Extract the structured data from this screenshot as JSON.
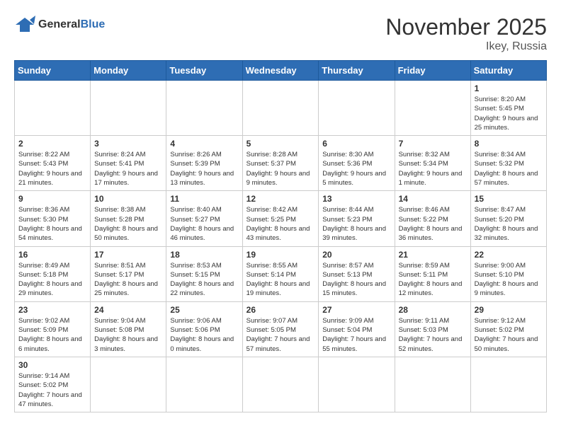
{
  "header": {
    "logo_general": "General",
    "logo_blue": "Blue",
    "month_title": "November 2025",
    "location": "Ikey, Russia"
  },
  "weekdays": [
    "Sunday",
    "Monday",
    "Tuesday",
    "Wednesday",
    "Thursday",
    "Friday",
    "Saturday"
  ],
  "weeks": [
    [
      {
        "day": "",
        "info": ""
      },
      {
        "day": "",
        "info": ""
      },
      {
        "day": "",
        "info": ""
      },
      {
        "day": "",
        "info": ""
      },
      {
        "day": "",
        "info": ""
      },
      {
        "day": "",
        "info": ""
      },
      {
        "day": "1",
        "info": "Sunrise: 8:20 AM\nSunset: 5:45 PM\nDaylight: 9 hours and 25 minutes."
      }
    ],
    [
      {
        "day": "2",
        "info": "Sunrise: 8:22 AM\nSunset: 5:43 PM\nDaylight: 9 hours and 21 minutes."
      },
      {
        "day": "3",
        "info": "Sunrise: 8:24 AM\nSunset: 5:41 PM\nDaylight: 9 hours and 17 minutes."
      },
      {
        "day": "4",
        "info": "Sunrise: 8:26 AM\nSunset: 5:39 PM\nDaylight: 9 hours and 13 minutes."
      },
      {
        "day": "5",
        "info": "Sunrise: 8:28 AM\nSunset: 5:37 PM\nDaylight: 9 hours and 9 minutes."
      },
      {
        "day": "6",
        "info": "Sunrise: 8:30 AM\nSunset: 5:36 PM\nDaylight: 9 hours and 5 minutes."
      },
      {
        "day": "7",
        "info": "Sunrise: 8:32 AM\nSunset: 5:34 PM\nDaylight: 9 hours and 1 minute."
      },
      {
        "day": "8",
        "info": "Sunrise: 8:34 AM\nSunset: 5:32 PM\nDaylight: 8 hours and 57 minutes."
      }
    ],
    [
      {
        "day": "9",
        "info": "Sunrise: 8:36 AM\nSunset: 5:30 PM\nDaylight: 8 hours and 54 minutes."
      },
      {
        "day": "10",
        "info": "Sunrise: 8:38 AM\nSunset: 5:28 PM\nDaylight: 8 hours and 50 minutes."
      },
      {
        "day": "11",
        "info": "Sunrise: 8:40 AM\nSunset: 5:27 PM\nDaylight: 8 hours and 46 minutes."
      },
      {
        "day": "12",
        "info": "Sunrise: 8:42 AM\nSunset: 5:25 PM\nDaylight: 8 hours and 43 minutes."
      },
      {
        "day": "13",
        "info": "Sunrise: 8:44 AM\nSunset: 5:23 PM\nDaylight: 8 hours and 39 minutes."
      },
      {
        "day": "14",
        "info": "Sunrise: 8:46 AM\nSunset: 5:22 PM\nDaylight: 8 hours and 36 minutes."
      },
      {
        "day": "15",
        "info": "Sunrise: 8:47 AM\nSunset: 5:20 PM\nDaylight: 8 hours and 32 minutes."
      }
    ],
    [
      {
        "day": "16",
        "info": "Sunrise: 8:49 AM\nSunset: 5:18 PM\nDaylight: 8 hours and 29 minutes."
      },
      {
        "day": "17",
        "info": "Sunrise: 8:51 AM\nSunset: 5:17 PM\nDaylight: 8 hours and 25 minutes."
      },
      {
        "day": "18",
        "info": "Sunrise: 8:53 AM\nSunset: 5:15 PM\nDaylight: 8 hours and 22 minutes."
      },
      {
        "day": "19",
        "info": "Sunrise: 8:55 AM\nSunset: 5:14 PM\nDaylight: 8 hours and 19 minutes."
      },
      {
        "day": "20",
        "info": "Sunrise: 8:57 AM\nSunset: 5:13 PM\nDaylight: 8 hours and 15 minutes."
      },
      {
        "day": "21",
        "info": "Sunrise: 8:59 AM\nSunset: 5:11 PM\nDaylight: 8 hours and 12 minutes."
      },
      {
        "day": "22",
        "info": "Sunrise: 9:00 AM\nSunset: 5:10 PM\nDaylight: 8 hours and 9 minutes."
      }
    ],
    [
      {
        "day": "23",
        "info": "Sunrise: 9:02 AM\nSunset: 5:09 PM\nDaylight: 8 hours and 6 minutes."
      },
      {
        "day": "24",
        "info": "Sunrise: 9:04 AM\nSunset: 5:08 PM\nDaylight: 8 hours and 3 minutes."
      },
      {
        "day": "25",
        "info": "Sunrise: 9:06 AM\nSunset: 5:06 PM\nDaylight: 8 hours and 0 minutes."
      },
      {
        "day": "26",
        "info": "Sunrise: 9:07 AM\nSunset: 5:05 PM\nDaylight: 7 hours and 57 minutes."
      },
      {
        "day": "27",
        "info": "Sunrise: 9:09 AM\nSunset: 5:04 PM\nDaylight: 7 hours and 55 minutes."
      },
      {
        "day": "28",
        "info": "Sunrise: 9:11 AM\nSunset: 5:03 PM\nDaylight: 7 hours and 52 minutes."
      },
      {
        "day": "29",
        "info": "Sunrise: 9:12 AM\nSunset: 5:02 PM\nDaylight: 7 hours and 50 minutes."
      }
    ],
    [
      {
        "day": "30",
        "info": "Sunrise: 9:14 AM\nSunset: 5:02 PM\nDaylight: 7 hours and 47 minutes."
      },
      {
        "day": "",
        "info": ""
      },
      {
        "day": "",
        "info": ""
      },
      {
        "day": "",
        "info": ""
      },
      {
        "day": "",
        "info": ""
      },
      {
        "day": "",
        "info": ""
      },
      {
        "day": "",
        "info": ""
      }
    ]
  ]
}
